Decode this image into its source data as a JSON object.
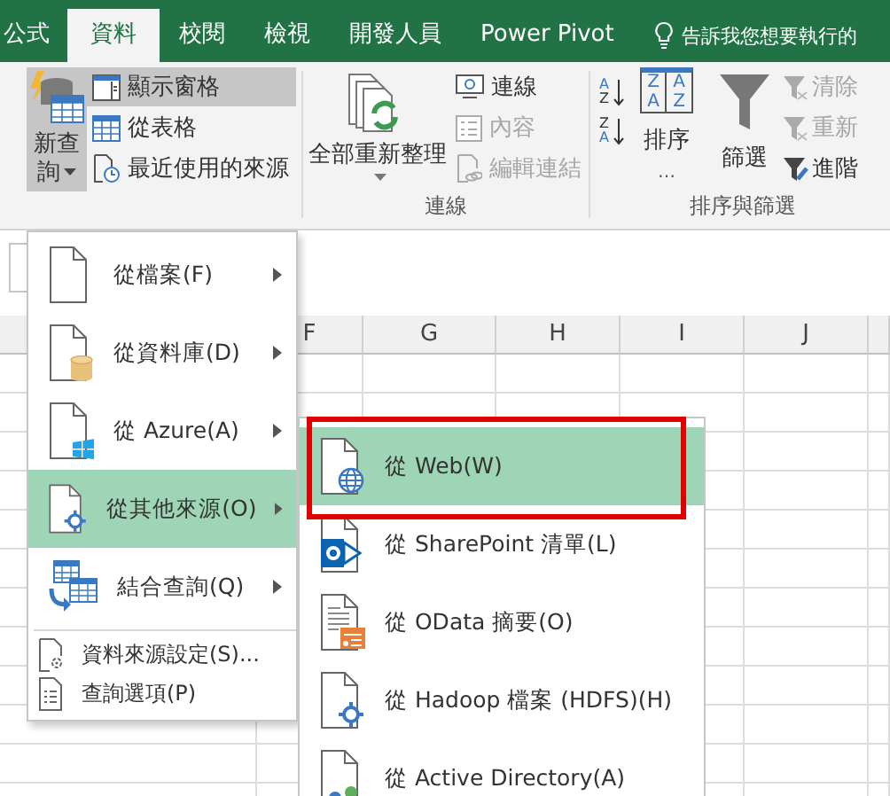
{
  "tabs": [
    {
      "label": "公式",
      "selected": false
    },
    {
      "label": "資料",
      "selected": true
    },
    {
      "label": "校閱",
      "selected": false
    },
    {
      "label": "檢視",
      "selected": false
    },
    {
      "label": "開發人員",
      "selected": false
    },
    {
      "label": "Power Pivot",
      "selected": false
    }
  ],
  "tell_me": {
    "placeholder": "告訴我您想要執行的"
  },
  "get_transform": {
    "new_query": {
      "label": "新查詢",
      "expanded": true
    },
    "items": [
      {
        "label": "顯示窗格",
        "selected": true
      },
      {
        "label": "從表格",
        "selected": false
      },
      {
        "label": "最近使用的來源",
        "selected": false
      }
    ]
  },
  "connections": {
    "refresh_all": {
      "label": "全部重新整理"
    },
    "items": [
      {
        "label": "連線",
        "disabled": false
      },
      {
        "label": "內容",
        "disabled": true
      },
      {
        "label": "編輯連結",
        "disabled": true
      }
    ],
    "group_label": "連線"
  },
  "sort_filter": {
    "sort_ascending": {
      "top": "A",
      "bottom": "Z"
    },
    "sort_descending": {
      "top": "Z",
      "bottom": "A"
    },
    "sort": {
      "label": "排序",
      "icon_letters": [
        "Z",
        "A",
        "A",
        "Z"
      ],
      "more": "…"
    },
    "filter": {
      "label": "篩選"
    },
    "items": [
      {
        "label": "清除",
        "disabled": true
      },
      {
        "label": "重新",
        "disabled": true
      },
      {
        "label": "進階",
        "disabled": false
      }
    ],
    "group_label": "排序與篩選"
  },
  "sheet": {
    "columns": [
      "F",
      "G",
      "H",
      "I",
      "J"
    ]
  },
  "new_query_menu": [
    {
      "kind": "large",
      "label": "從檔案(F)",
      "has_submenu": true,
      "selected": false
    },
    {
      "kind": "large",
      "label": "從資料庫(D)",
      "has_submenu": true,
      "selected": false
    },
    {
      "kind": "large",
      "label": "從 Azure(A)",
      "has_submenu": true,
      "selected": false
    },
    {
      "kind": "large",
      "label": "從其他來源(O)",
      "has_submenu": true,
      "selected": true
    },
    {
      "kind": "large",
      "label": "結合查詢(Q)",
      "has_submenu": true,
      "selected": false
    },
    {
      "kind": "small",
      "label": "資料來源設定(S)...",
      "has_submenu": false,
      "selected": false
    },
    {
      "kind": "small",
      "label": "查詢選項(P)",
      "has_submenu": false,
      "selected": false
    }
  ],
  "submenu": [
    {
      "label": "從 Web(W)",
      "selected": true,
      "outlined": true
    },
    {
      "label": "從 SharePoint 清單(L)",
      "selected": false,
      "outlined": false
    },
    {
      "label": "從 OData 摘要(O)",
      "selected": false,
      "outlined": false
    },
    {
      "label": "從 Hadoop 檔案 (HDFS)(H)",
      "selected": false,
      "outlined": false
    },
    {
      "label": "從 Active Directory(A)",
      "selected": false,
      "outlined": false
    }
  ]
}
